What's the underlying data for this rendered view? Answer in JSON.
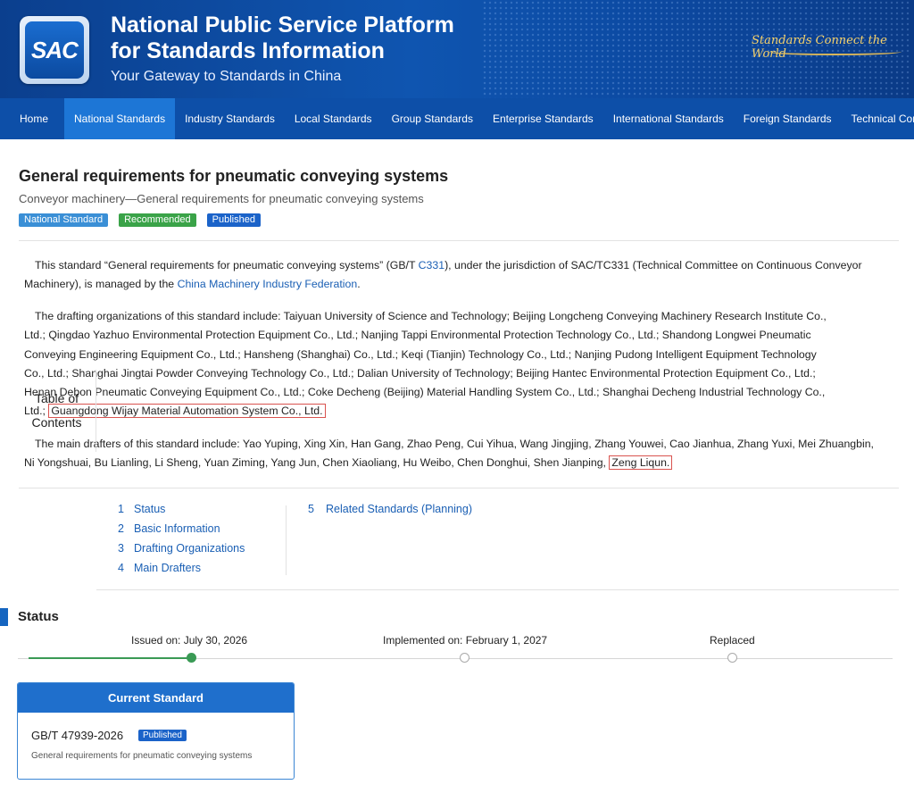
{
  "header": {
    "logo_text": "SAC",
    "title_line1": "National Public Service Platform",
    "title_line2": "for Standards Information",
    "tagline": "Your Gateway to Standards in China",
    "slogan": "Standards Connect the World"
  },
  "nav": {
    "items": [
      {
        "label": "Home",
        "active": false
      },
      {
        "label": "National Standards",
        "active": true
      },
      {
        "label": "Industry Standards",
        "active": false
      },
      {
        "label": "Local Standards",
        "active": false
      },
      {
        "label": "Group Standards",
        "active": false
      },
      {
        "label": "Enterprise Standards",
        "active": false
      },
      {
        "label": "International Standards",
        "active": false
      },
      {
        "label": "Foreign Standards",
        "active": false
      },
      {
        "label": "Technical Committees",
        "active": false
      }
    ]
  },
  "standard": {
    "title": "General requirements for pneumatic conveying systems",
    "subtitle": "Conveyor machinery—General requirements for pneumatic conveying systems",
    "tags": [
      "National Standard",
      "Recommended",
      "Published"
    ]
  },
  "description": {
    "p1_a": "This standard “General requirements for pneumatic conveying systems” (GB/T ",
    "p1_link1": "C331",
    "p1_b": "), under the jurisdiction of SAC/TC331 (Technical Committee on Continuous Conveyor Machinery), is managed by the ",
    "p1_link2": "China Machinery Industry Federation",
    "p1_c": ".",
    "p2_a": "The drafting organizations of this standard include: Taiyuan University of Science and Technology; Beijing Longcheng Conveying Machinery Research Institute Co., Ltd.; Qingdao Yazhuo Environmental Protection Equipment Co., Ltd.; Nanjing Tappi Environmental Protection Technology Co., Ltd.; Shandong Longwei Pneumatic Conveying Engineering Equipment Co., Ltd.; Hansheng (Shanghai) Co., Ltd.; Keqi (Tianjin) Technology Co., Ltd.; Nanjing Pudong Intelligent Equipment Technology Co., Ltd.; Shanghai Jingtai Powder Conveying Technology Co., Ltd.; Dalian University of Technology; Beijing Hantec Environmental Protection Equipment Co., Ltd.; Henan Debon Pneumatic Conveying Equipment Co., Ltd.; Coke Decheng (Beijing) Material Handling System Co., Ltd.; Shanghai Decheng Industrial Technology Co., Ltd.; ",
    "p2_highlight": "Guangdong Wijay Material Automation System Co., Ltd.",
    "p3_a": "The main drafters of this standard include: Yao Yuping, Xing Xin, Han Gang, Zhao Peng, Cui Yihua, Wang Jingjing, Zhang Youwei, Cao Jianhua, Zhang Yuxi, Mei Zhuangbin, Ni Yongshuai, Bu Lianling, Li Sheng, Yuan Ziming, Yang Jun, Chen Xiaoliang, Hu Weibo, Chen Donghui, Shen Jianping, ",
    "p3_highlight": "Zeng Liqun."
  },
  "toc": {
    "label_line1": "Table of",
    "label_line2": "Contents",
    "items": [
      {
        "num": "1",
        "label": "Status"
      },
      {
        "num": "2",
        "label": "Basic Information"
      },
      {
        "num": "3",
        "label": "Drafting Organizations"
      },
      {
        "num": "4",
        "label": "Main Drafters"
      },
      {
        "num": "5",
        "label": "Related Standards (Planning)"
      }
    ]
  },
  "status": {
    "heading": "Status",
    "timeline": [
      {
        "label": "Issued on: July 30, 2026",
        "done": true
      },
      {
        "label": "Implemented on: February 1, 2027",
        "done": false
      },
      {
        "label": "Replaced",
        "done": false
      }
    ],
    "card": {
      "header": "Current Standard",
      "number": "GB/T 47939-2026",
      "badge": "Published",
      "description": "General requirements for pneumatic conveying systems"
    }
  },
  "colors": {
    "nav_bg": "#0d4fa8",
    "nav_active": "#1d76d6",
    "link": "#1a5fb4",
    "highlight_border": "#d9534f",
    "done_green": "#3a9a55"
  }
}
